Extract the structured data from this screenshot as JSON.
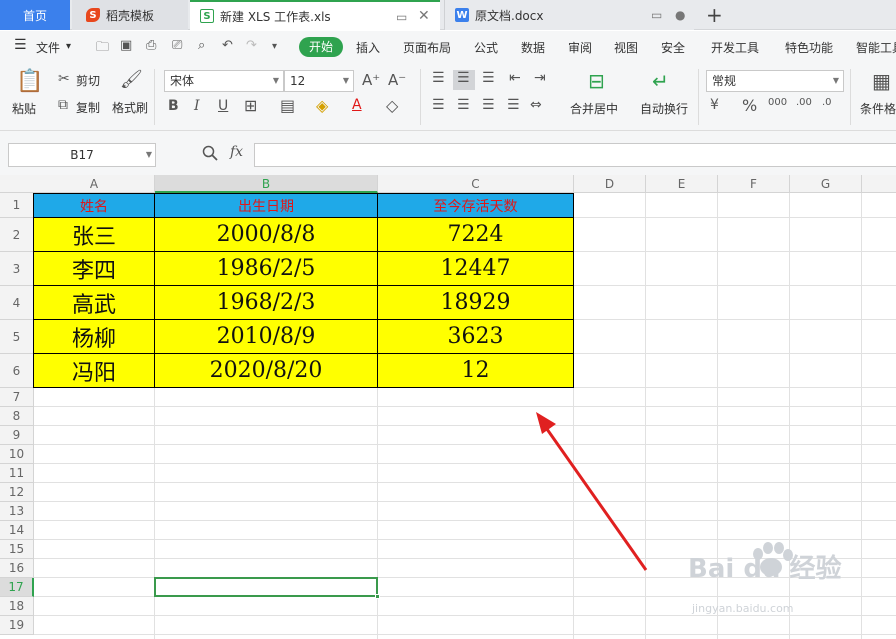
{
  "tabs": [
    {
      "label": "首页"
    },
    {
      "label": "稻壳模板"
    },
    {
      "label": "新建 XLS 工作表.xls"
    },
    {
      "label": "原文档.docx"
    }
  ],
  "menu": {
    "file": "文件",
    "items": [
      "开始",
      "插入",
      "页面布局",
      "公式",
      "数据",
      "审阅",
      "视图",
      "安全",
      "开发工具",
      "特色功能",
      "智能工具"
    ]
  },
  "toolbar": {
    "paste": "粘贴",
    "cut": "剪切",
    "copy": "复制",
    "format_painter": "格式刷",
    "font_name": "宋体",
    "font_size": "12",
    "merge_center": "合并居中",
    "wrap_text": "自动换行",
    "number_format": "常规",
    "conditional_format": "条件格"
  },
  "formula_bar": {
    "name_box": "B17",
    "fx": "fx",
    "formula": ""
  },
  "columns": [
    "A",
    "B",
    "C",
    "D",
    "E",
    "F",
    "G"
  ],
  "rows": [
    "1",
    "2",
    "3",
    "4",
    "5",
    "6",
    "7",
    "8",
    "9",
    "10",
    "11",
    "12",
    "13",
    "14",
    "15",
    "16",
    "17",
    "18",
    "19"
  ],
  "table": {
    "headers": [
      "姓名",
      "出生日期",
      "至今存活天数"
    ],
    "rows": [
      [
        "张三",
        "2000/8/8",
        "7224"
      ],
      [
        "李四",
        "1986/2/5",
        "12447"
      ],
      [
        "高武",
        "1968/2/3",
        "18929"
      ],
      [
        "杨柳",
        "2010/8/9",
        "3623"
      ],
      [
        "冯阳",
        "2020/8/20",
        "12"
      ]
    ]
  },
  "selection": {
    "cell": "B17",
    "color": "#2fa34f"
  },
  "watermark": {
    "text": "Bai du 经验",
    "sub": "jingyan.baidu.com"
  },
  "colors": {
    "header_fill": "#1fa9e8",
    "header_text": "#e01818",
    "body_fill": "#ffff00",
    "accent": "#2fa34f",
    "arrow": "#e02020"
  }
}
